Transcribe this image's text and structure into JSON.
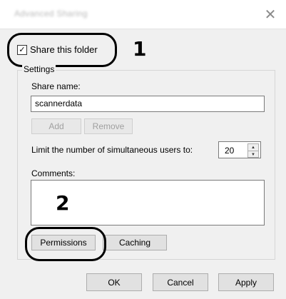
{
  "dialog": {
    "title": "Advanced Sharing",
    "close_glyph": "✕"
  },
  "share": {
    "label": "Share this folder",
    "checked": true,
    "check_glyph": "✓"
  },
  "callouts": {
    "one": "1",
    "two": "2"
  },
  "settings": {
    "group_label": "Settings",
    "share_name_label": "Share name:",
    "share_name_value": "scannerdata",
    "add_label": "Add",
    "remove_label": "Remove",
    "limit_label": "Limit the number of simultaneous users to:",
    "limit_value": "20",
    "comments_label": "Comments:",
    "comments_value": "",
    "permissions_label": "Permissions",
    "caching_label": "Caching"
  },
  "footer": {
    "ok_label": "OK",
    "cancel_label": "Cancel",
    "apply_label": "Apply"
  }
}
